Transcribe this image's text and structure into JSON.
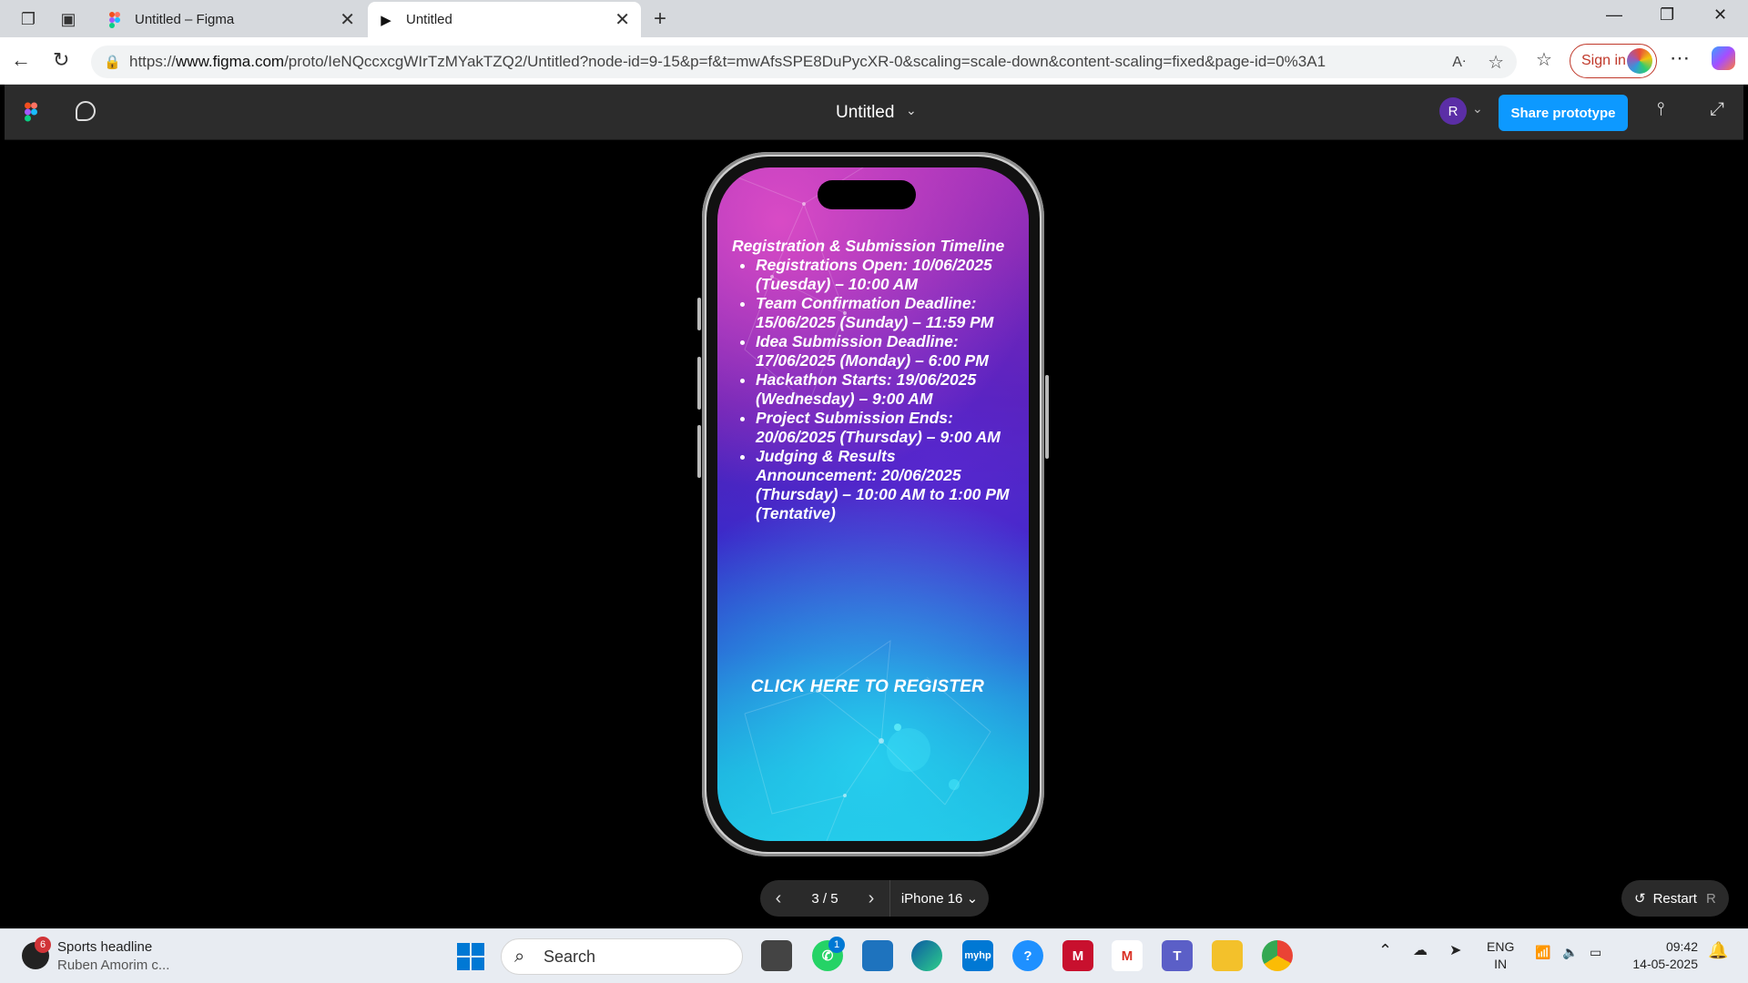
{
  "browser": {
    "tabs": [
      {
        "title": "Untitled – Figma",
        "active": false
      },
      {
        "title": "Untitled",
        "active": true
      }
    ],
    "url_prefix": "https://",
    "url_domain": "www.figma.com",
    "url_path": "/proto/IeNQccxcgWIrTzMYakTZQ2/Untitled?node-id=9-15&p=f&t=mwAfsSPE8DuPycXR-0&scaling=scale-down&content-scaling=fixed&page-id=0%3A1",
    "sign_in": "Sign in"
  },
  "figma": {
    "title": "Untitled",
    "user_initial": "R",
    "share_label": "Share prototype"
  },
  "screen": {
    "heading": "Registration & Submission Timeline",
    "items": [
      "Registrations Open: 10/06/2025 (Tuesday) – 10:00 AM",
      "Team Confirmation Deadline: 15/06/2025 (Sunday) – 11:59 PM",
      "Idea Submission Deadline: 17/06/2025 (Monday) – 6:00 PM",
      "Hackathon Starts: 19/06/2025 (Wednesday) – 9:00 AM",
      "Project Submission Ends: 20/06/2025 (Thursday) – 9:00 AM",
      "Judging & Results Announcement: 20/06/2025 (Thursday) – 10:00 AM to 1:00 PM (Tentative)"
    ],
    "register": "CLICK HERE TO REGISTER"
  },
  "controls": {
    "page": "3 / 5",
    "device": "iPhone 16",
    "restart": "Restart",
    "restart_key": "R"
  },
  "taskbar": {
    "news_title": "Sports headline",
    "news_sub": "Ruben Amorim c...",
    "news_badge": "6",
    "search": "Search",
    "whatsapp_badge": "1",
    "lang1": "ENG",
    "lang2": "IN",
    "time": "09:42",
    "date": "14-05-2025"
  }
}
